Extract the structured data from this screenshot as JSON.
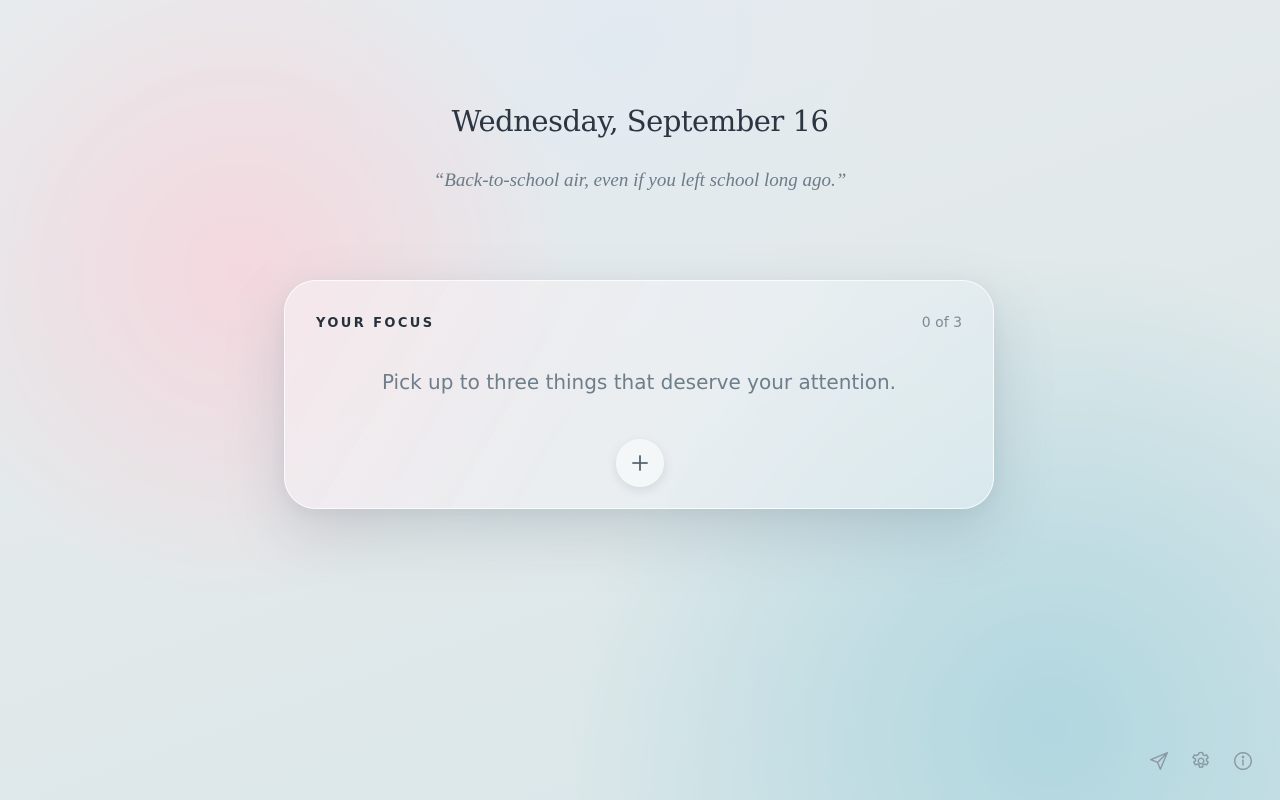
{
  "header": {
    "date": "Wednesday, September 16",
    "quote": "“Back-to-school air, even if you left school long ago.”"
  },
  "focus_card": {
    "label": "YOUR FOCUS",
    "count": "0 of 3",
    "prompt": "Pick up to three things that deserve your attention.",
    "add_icon": "plus-icon"
  },
  "footer": {
    "icons": [
      "send-icon",
      "gear-icon",
      "info-icon"
    ]
  },
  "colors": {
    "text_dark": "#2b3642",
    "text_muted": "#6e7f8b",
    "icon_muted": "#8a9aa5",
    "background_pink": "#f5d7de",
    "background_teal": "#afd6df"
  }
}
